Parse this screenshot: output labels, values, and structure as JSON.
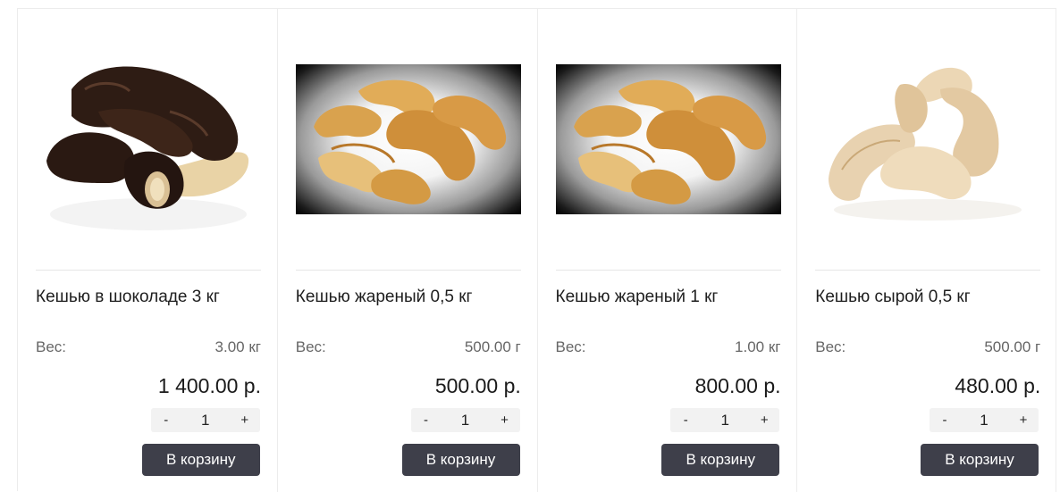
{
  "products": [
    {
      "title": "Кешью в шоколаде 3 кг",
      "weight_label": "Вес:",
      "weight_value": "3.00 кг",
      "price": "1 400.00 р.",
      "qty_minus": "-",
      "qty_value": "1",
      "qty_plus": "+",
      "cart_label": "В корзину",
      "image_icon": "chocolate-cashew-image"
    },
    {
      "title": "Кешью жареный 0,5 кг",
      "weight_label": "Вес:",
      "weight_value": "500.00 г",
      "price": "500.00 р.",
      "qty_minus": "-",
      "qty_value": "1",
      "qty_plus": "+",
      "cart_label": "В корзину",
      "image_icon": "roasted-cashew-image"
    },
    {
      "title": "Кешью жареный 1 кг",
      "weight_label": "Вес:",
      "weight_value": "1.00 кг",
      "price": "800.00 р.",
      "qty_minus": "-",
      "qty_value": "1",
      "qty_plus": "+",
      "cart_label": "В корзину",
      "image_icon": "roasted-cashew-image"
    },
    {
      "title": "Кешью сырой 0,5 кг",
      "weight_label": "Вес:",
      "weight_value": "500.00 г",
      "price": "480.00 р.",
      "qty_minus": "-",
      "qty_value": "1",
      "qty_plus": "+",
      "cart_label": "В корзину",
      "image_icon": "raw-cashew-image"
    }
  ],
  "colors": {
    "cart_button": "#3e3f4a",
    "qty_background": "#f2f2f2",
    "border": "#ececec"
  }
}
